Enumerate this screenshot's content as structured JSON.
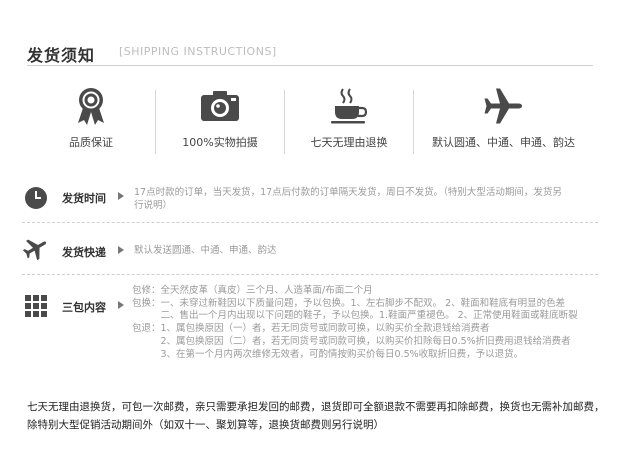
{
  "header": {
    "title": "发货须知",
    "subtitle": "[SHIPPING INSTRUCTIONS]"
  },
  "features": [
    {
      "icon": "award-ribbon-icon",
      "label": "品质保证"
    },
    {
      "icon": "camera-icon",
      "label": "100%实物拍摄"
    },
    {
      "icon": "coffee-cup-icon",
      "label": "七天无理由退换"
    },
    {
      "icon": "airplane-icon",
      "label": "默认圆通、中通、申通、韵达"
    }
  ],
  "rows": {
    "shipping_time": {
      "icon": "clock-icon",
      "label": "发货时间",
      "text_line1": "17点时款的订单，当天发货，17点后付款的订单隔天发货，周日不发货。（特别大型活动期间，发货另",
      "text_line2": "行说明）"
    },
    "shipping_express": {
      "icon": "airplane-icon",
      "label": "发货快递",
      "text": "默认发送圆通、中通、申通、韵达"
    },
    "three_guarantees": {
      "icon": "grid-icon",
      "label": "三包内容",
      "lines": [
        "包修：全天然皮革（真皮）三个月、人造革面/布面二个月",
        "包换：一、未穿过新鞋因以下质量问题，予以包换。1、左右脚步不配双。 2、鞋面和鞋底有明显的色差",
        "　　　二、售出一个月内出现以下问题的鞋子，予以包换。1.鞋面严重褪色。 2、正常使用鞋面或鞋底断裂",
        "包退：1、属包换原因（一）者，若无同货号或同款可换，以购买价全款退钱给消费者",
        "　　　2、属包换原因（二）者，若无同货号或同款可换，以购买价扣除每日0.5%折旧费用退钱给消费者",
        "　　　3、在第一个月内两次维修无效者，可酌情按购买价每日0.5%收取折旧费，予以退货。"
      ]
    }
  },
  "footer": {
    "line1": "七天无理由退换货，可包一次邮费，亲只需要承担发回的邮费，退货即可全额退款不需要再扣除邮费，换货也无需补加邮费，",
    "line2": "除特别大型促销活动期间外（如双十一、聚划算等，退换货邮费则另行说明）"
  },
  "colors": {
    "icon": "#4a4a4a",
    "label_text": "#333333",
    "body_text": "#9a9a9a",
    "rule": "#cfcfcf"
  }
}
